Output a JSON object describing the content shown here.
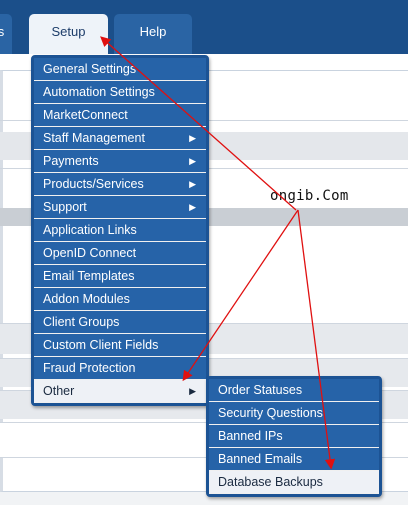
{
  "nav": {
    "tabs": [
      {
        "label": "s"
      },
      {
        "label": "Setup"
      },
      {
        "label": "Help"
      }
    ]
  },
  "setup_menu": {
    "items": [
      {
        "label": "General Settings",
        "submenu": false
      },
      {
        "label": "Automation Settings",
        "submenu": false
      },
      {
        "label": "MarketConnect",
        "submenu": false
      },
      {
        "label": "Staff Management",
        "submenu": true
      },
      {
        "label": "Payments",
        "submenu": true
      },
      {
        "label": "Products/Services",
        "submenu": true
      },
      {
        "label": "Support",
        "submenu": true
      },
      {
        "label": "Application Links",
        "submenu": false
      },
      {
        "label": "OpenID Connect",
        "submenu": false
      },
      {
        "label": "Email Templates",
        "submenu": false
      },
      {
        "label": "Addon Modules",
        "submenu": false
      },
      {
        "label": "Client Groups",
        "submenu": false
      },
      {
        "label": "Custom Client Fields",
        "submenu": false
      },
      {
        "label": "Fraud Protection",
        "submenu": false
      },
      {
        "label": "Other",
        "submenu": true
      }
    ],
    "submenu_arrow": "▶"
  },
  "other_submenu": {
    "items": [
      {
        "label": "Order Statuses"
      },
      {
        "label": "Security Questions"
      },
      {
        "label": "Banned IPs"
      },
      {
        "label": "Banned Emails"
      },
      {
        "label": "Database Backups"
      }
    ]
  },
  "watermark": "ongib.Com",
  "colors": {
    "nav_bg": "#1b4f8a",
    "menu_item": "#2663a8",
    "menu_border": "#1c5394",
    "highlight": "#eef1f6",
    "annotation_arrow": "#e01010"
  }
}
